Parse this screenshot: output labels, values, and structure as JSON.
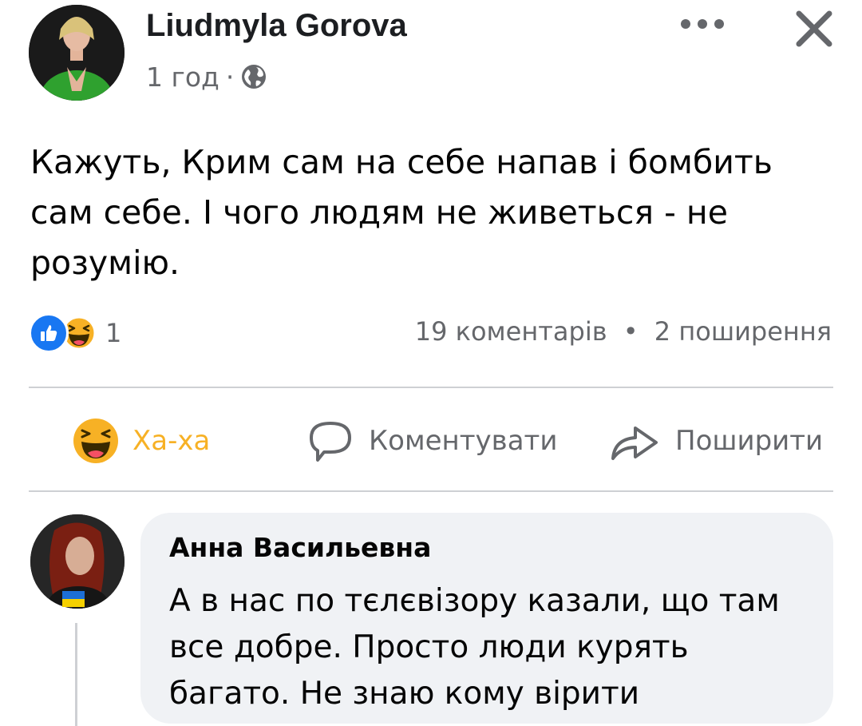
{
  "post": {
    "author": "Liudmyla Gorova",
    "time": "1 год",
    "meta_separator": "·",
    "privacy_icon": "globe-icon",
    "text": "Кажуть, Крим сам на себе напав і бомбить сам себе. І чого людям не живеться - не розумію."
  },
  "header": {
    "more_icon": "more-horizontal-icon",
    "close_icon": "close-icon"
  },
  "reactions": {
    "icons": [
      "like-reaction-icon",
      "haha-reaction-icon"
    ],
    "count": "1"
  },
  "counts": {
    "comments": "19 коментарів",
    "separator": "•",
    "shares": "2 поширення"
  },
  "actions": {
    "haha_label": "Ха-ха",
    "comment_label": "Коментувати",
    "share_label": "Поширити"
  },
  "comment": {
    "author": "Анна Васильевна",
    "text": "А в нас по тєлєвізору казали, що там все добре. Просто люди курять багато. Не знаю кому вірити"
  },
  "colors": {
    "text_primary": "#050505",
    "text_secondary": "#65676b",
    "like_blue": "#1877f2",
    "haha_yellow": "#f7b125",
    "bubble_bg": "#f0f2f5",
    "divider": "#ced0d4"
  }
}
